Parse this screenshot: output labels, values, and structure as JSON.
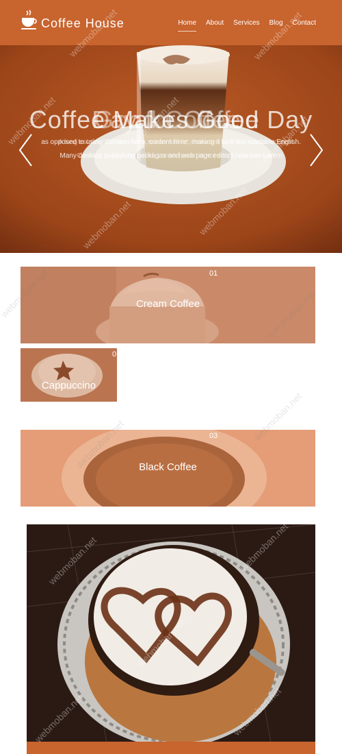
{
  "header": {
    "brand": "Coffee House",
    "nav": [
      "Home",
      "About",
      "Services",
      "Blog",
      "Contact"
    ],
    "active_index": 0
  },
  "hero": {
    "titles": [
      "Coffee Makes Good Day",
      "Day for Coffee",
      "Good Coffee"
    ],
    "line1_a": "as opposed to using 'Content here, content here', making it look like readable English.",
    "line1_b": "A long established fact that a reader will be distracted by the readable content",
    "line2_a": "Many desktop publishing packages and web page editors now use Lorem",
    "line2_b": "Contrary to popular belief, Lorem Ipsum is not simply random text"
  },
  "features": [
    {
      "title": "Cream Coffee",
      "num": "01"
    },
    {
      "title": "Cappuccino",
      "num": "0"
    },
    {
      "title": "Black Coffee",
      "num": "03"
    }
  ],
  "watermark": "webmoban.net",
  "colors": {
    "brand": "#c8642e",
    "accent_line": "#f3d8c5"
  }
}
